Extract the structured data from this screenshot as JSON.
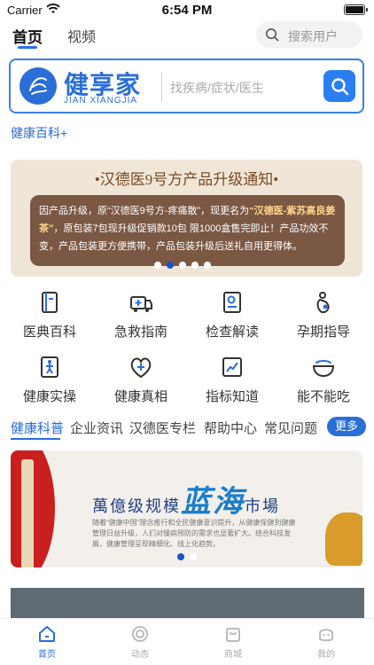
{
  "status_bar": {
    "carrier": "Carrier",
    "time": "6:54 PM"
  },
  "top_nav": {
    "tabs": [
      {
        "label": "首页",
        "active": true
      },
      {
        "label": "视频",
        "active": false
      }
    ],
    "user_search_placeholder": "搜索用户"
  },
  "brand_search": {
    "brand_name": "健享家",
    "brand_sub": "JIAN XIANGJIA",
    "placeholder": "找疾病/症状/医生"
  },
  "encyclopedia_link": "健康百科+",
  "notice": {
    "title": "•汉德医9号方产品升级通知•",
    "p1": "因产品升级，原“汉德医9号方-疼痛散”，现更名为",
    "p1_em": "“汉德医-紫苏高良姜茶”",
    "p2": "，原包装7包现升级促销款10包 限1000盒售完即止！产品功效不变，产品包装更方便携带，产品包装升级后送礼自用更得体。"
  },
  "grid": [
    {
      "label": "医典百科",
      "icon": "book-icon"
    },
    {
      "label": "急救指南",
      "icon": "ambulance-icon"
    },
    {
      "label": "检查解读",
      "icon": "report-icon"
    },
    {
      "label": "孕期指导",
      "icon": "pregnancy-icon"
    },
    {
      "label": "健康实操",
      "icon": "exercise-icon"
    },
    {
      "label": "健康真相",
      "icon": "heart-plus-icon"
    },
    {
      "label": "指标知道",
      "icon": "trend-chart-icon"
    },
    {
      "label": "能不能吃",
      "icon": "food-bowl-icon"
    }
  ],
  "category_tabs": [
    {
      "label": "健康科普",
      "active": true
    },
    {
      "label": "企业资讯",
      "active": false
    },
    {
      "label": "汉德医专栏",
      "active": false
    },
    {
      "label": "帮助中心",
      "active": false
    },
    {
      "label": "常见问题",
      "active": false
    }
  ],
  "more_label": "更多",
  "promo": {
    "title_a": "萬億级规模",
    "title_big": "蓝海",
    "title_b": "市場",
    "text": "随着“健康中国”理念推行和全民健康意识提升，从健康保健到健康管理日益升级，人们对慢病预防的需求也显著扩大。结合科技发展，健康管理呈现精细化、线上化趋势。"
  },
  "tab_bar": [
    {
      "label": "首页",
      "active": true,
      "icon": "home-icon"
    },
    {
      "label": "动态",
      "active": false,
      "icon": "moments-icon"
    },
    {
      "label": "商城",
      "active": false,
      "icon": "shop-bag-icon"
    },
    {
      "label": "我的",
      "active": false,
      "icon": "profile-face-icon"
    }
  ],
  "colors": {
    "accent": "#2a6ed8",
    "notice_bg": "#efe6d8",
    "notice_card": "#7b5844",
    "promo_red": "#c91f1f"
  }
}
